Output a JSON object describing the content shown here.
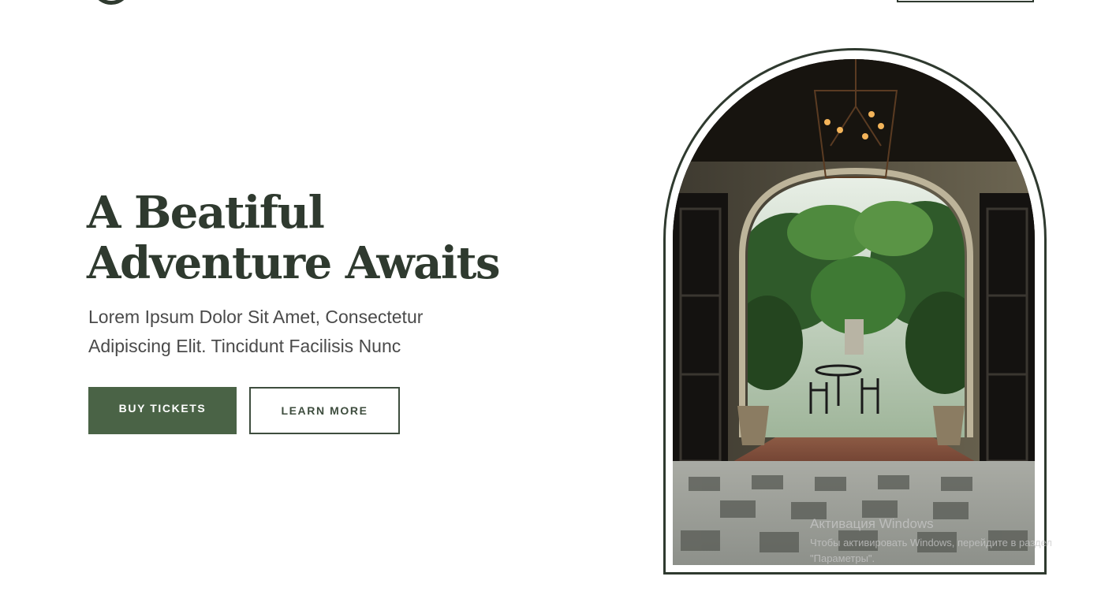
{
  "hero": {
    "title_line1": "A Beatiful",
    "title_line2": "Adventure Awaits",
    "subtitle_line1": "Lorem Ipsum Dolor Sit Amet, Consectetur",
    "subtitle_line2": "Adipiscing Elit. Tincidunt Facilisis Nunc",
    "primary_button": "BUY TICKETS",
    "secondary_button": "LEARN MORE"
  },
  "watermark": {
    "title": "Активация Windows",
    "line1": "Чтобы активировать Windows, перейдите в раздел",
    "line2": "\"Параметры\"."
  },
  "colors": {
    "dark_green": "#2f3a2f",
    "accent_green": "#4a6346",
    "text_gray": "#4a4a4a"
  }
}
